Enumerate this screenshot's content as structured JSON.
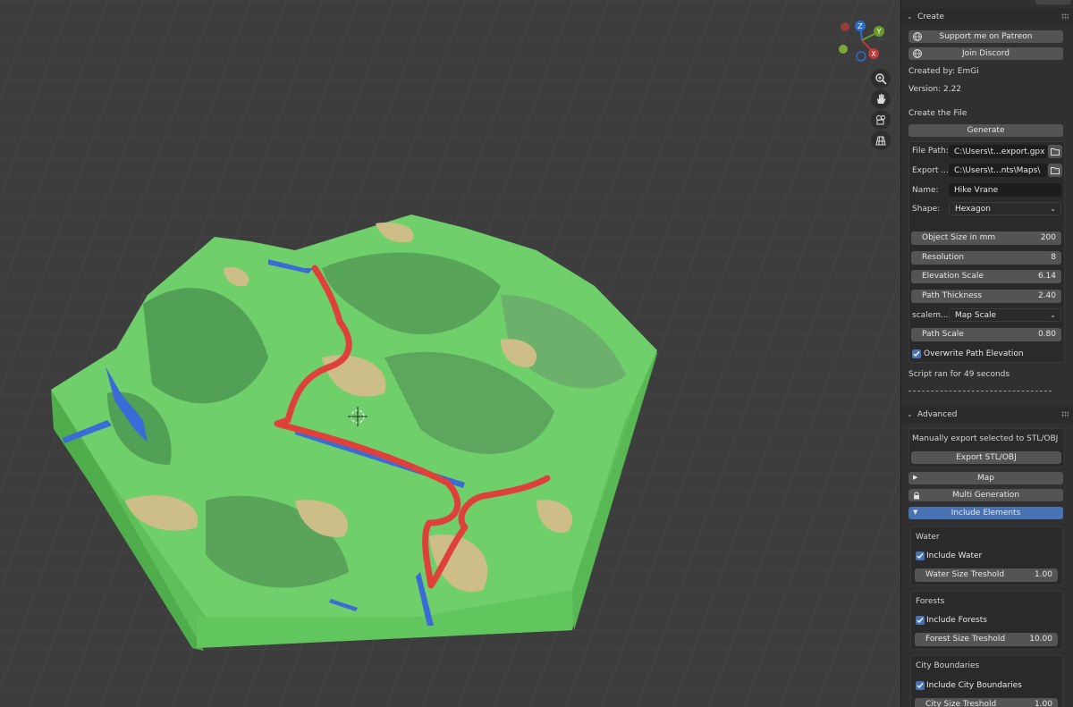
{
  "viewport": {
    "tools": [
      "zoom-icon",
      "hand-pan-icon",
      "camera-icon",
      "grid-ortho-icon"
    ],
    "gizmo": {
      "z": "Z",
      "y": "Y",
      "x": "X"
    }
  },
  "create_panel": {
    "title": "Create",
    "patreon_label": "Support me on Patreon",
    "discord_label": "Join Discord",
    "created_by": "Created by: EmGi",
    "version": "Version: 2.22",
    "create_file": "Create the File",
    "generate_label": "Generate",
    "file_path_label": "File Path:",
    "file_path_value": "C:\\Users\\t...export.gpx",
    "export_label": "Export ...",
    "export_value": "C:\\Users\\t...nts\\Maps\\",
    "name_label": "Name:",
    "name_value": "Hike Vrane",
    "shape_label": "Shape:",
    "shape_value": "Hexagon",
    "object_size_label": "Object Size in mm",
    "object_size_value": "200",
    "resolution_label": "Resolution",
    "resolution_value": "8",
    "elevation_label": "Elevation Scale",
    "elevation_value": "6.14",
    "path_thickness_label": "Path Thickness",
    "path_thickness_value": "2.40",
    "scale_mode_label": "scalem...",
    "scale_mode_value": "Map Scale",
    "path_scale_label": "Path Scale",
    "path_scale_value": "0.80",
    "overwrite_label": "Overwrite Path Elevation",
    "overwrite_checked": true,
    "script_status": "Script ran for 49 seconds",
    "separator": "--------------------------------"
  },
  "advanced_panel": {
    "title": "Advanced",
    "manual_export": "Manually export selected to STL/OBJ",
    "export_button": "Export STL/OBJ",
    "map_label": "Map",
    "multi_label": "Multi Generation",
    "include_label": "Include Elements",
    "water_title": "Water",
    "include_water": "Include Water",
    "water_threshold_label": "Water Size Treshold",
    "water_threshold_value": "1.00",
    "forests_title": "Forests",
    "include_forests": "Include Forests",
    "forest_threshold_label": "Forest Size Treshold",
    "forest_threshold_value": "10.00",
    "city_title": "City Boundaries",
    "include_city": "Include City Boundaries",
    "city_threshold_label": "City Size Treshold",
    "city_threshold_value": "1.00"
  },
  "colors": {
    "accent": "#4772b3",
    "terrain_green": "#6fcf6a",
    "forest_green": "#5aa75e",
    "path_red": "#e0403a",
    "water_blue": "#3a6bd6",
    "field_tan": "#cdbd86"
  }
}
